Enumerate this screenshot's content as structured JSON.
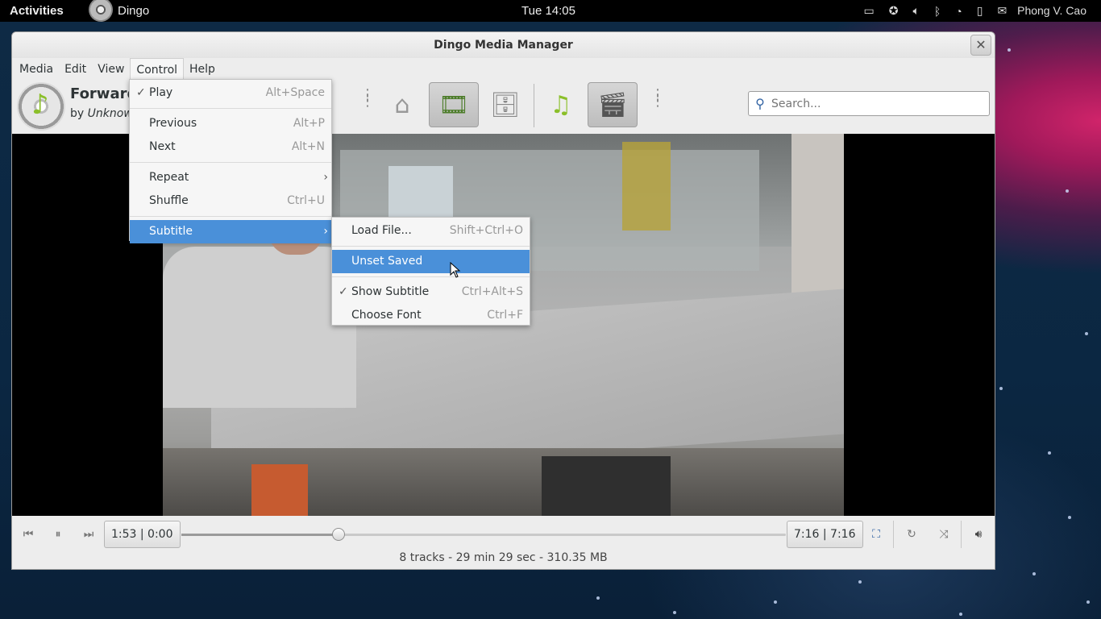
{
  "topbar": {
    "activities": "Activities",
    "app_name": "Dingo",
    "clock": "Tue 14:05",
    "user": "Phong V. Cao"
  },
  "window": {
    "title": "Dingo Media Manager"
  },
  "menubar": {
    "items": [
      "Media",
      "Edit",
      "View",
      "Control",
      "Help"
    ]
  },
  "now_playing": {
    "title": "Forward",
    "by_prefix": "by",
    "artist": "Unknown"
  },
  "search": {
    "placeholder": "Search..."
  },
  "control_menu": {
    "items": [
      {
        "label": "Play",
        "accel": "Alt+Space",
        "checked": true
      },
      {
        "label": "Previous",
        "accel": "Alt+P"
      },
      {
        "label": "Next",
        "accel": "Alt+N"
      },
      {
        "label": "Repeat",
        "submenu": true
      },
      {
        "label": "Shuffle",
        "accel": "Ctrl+U"
      },
      {
        "label": "Subtitle",
        "submenu": true,
        "highlighted": true
      }
    ]
  },
  "subtitle_menu": {
    "items": [
      {
        "label": "Load File...",
        "accel": "Shift+Ctrl+O"
      },
      {
        "label": "Unset Saved",
        "highlighted": true
      },
      {
        "label": "Show Subtitle",
        "accel": "Ctrl+Alt+S",
        "checked": true
      },
      {
        "label": "Choose Font",
        "accel": "Ctrl+F"
      }
    ]
  },
  "controls": {
    "elapsed": "1:53 | 0:00",
    "total": "7:16 | 7:16",
    "seek_fraction": 0.26
  },
  "status": "8 tracks - 29 min 29 sec - 310.35 MB",
  "colors": {
    "menu_highlight": "#4a90d9",
    "topbar": "#000000"
  }
}
